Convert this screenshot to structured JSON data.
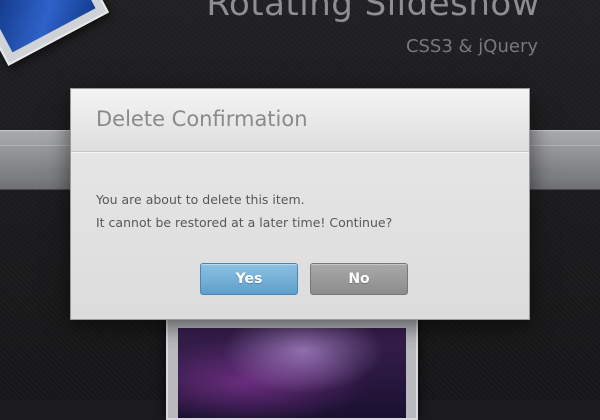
{
  "page": {
    "title": "Rotating Slideshow",
    "subtitle": "CSS3 & jQuery"
  },
  "dialog": {
    "title": "Delete Confirmation",
    "message_line1": "You are about to delete this item.",
    "message_line2": "It cannot be restored at a later time! Continue?",
    "yes_label": "Yes",
    "no_label": "No"
  },
  "colors": {
    "yes_button": "#6faad3",
    "no_button": "#999999",
    "dialog_background": "#e2e2e2",
    "page_background": "#1c1c1e"
  }
}
